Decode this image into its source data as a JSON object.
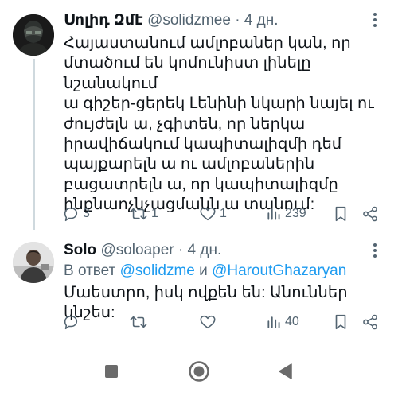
{
  "tweets": [
    {
      "author_name": "Սոլիդ Զմէ",
      "handle": "@solidzmee",
      "separator": "·",
      "time": "4 дн.",
      "text_lines": [
        "Հայաստանում ամլոբաներ կան, որ",
        "մտածում են կոմունիստ լինելը նշանակում",
        "ա գիշեր-ցերեկ Լենինի նկարի նայել ու",
        "ժույժելն ա, չգիտեն, որ ներկա",
        "իրավիճակում կապիտալիզմի դեմ",
        "պայքարելն ա ու  ամլոբաներին",
        "բացատրելն ա, որ կապիտալիզմը",
        "ինքնաոչնչացմանն ա տանում:"
      ],
      "replies": "3",
      "retweets": "1",
      "likes": "1",
      "views": "239",
      "avatar_icon": "dark-masked-figure-avatar"
    },
    {
      "author_name": "Solo",
      "handle": "@soloaper",
      "separator": "·",
      "time": "4 дн.",
      "reply_prefix": "В ответ",
      "reply_mention_1": "@solidzme",
      "reply_conj": "и",
      "reply_mention_2": "@HaroutGhazaryan",
      "text_lines": [
        "Մաեստրո, իսկ ովքեն են: Անուններ կնշես:"
      ],
      "replies": "",
      "retweets": "",
      "likes": "",
      "views": "40",
      "avatar_icon": "person-photo-avatar"
    }
  ],
  "colors": {
    "text": "#0f1419",
    "muted": "#536471",
    "link": "#1d9bf0",
    "thread_line": "#cfd9de",
    "nav_icons": "#6b6b6b"
  },
  "navbar": {
    "icons": [
      "square-recents-icon",
      "circle-home-icon",
      "triangle-back-icon"
    ]
  }
}
